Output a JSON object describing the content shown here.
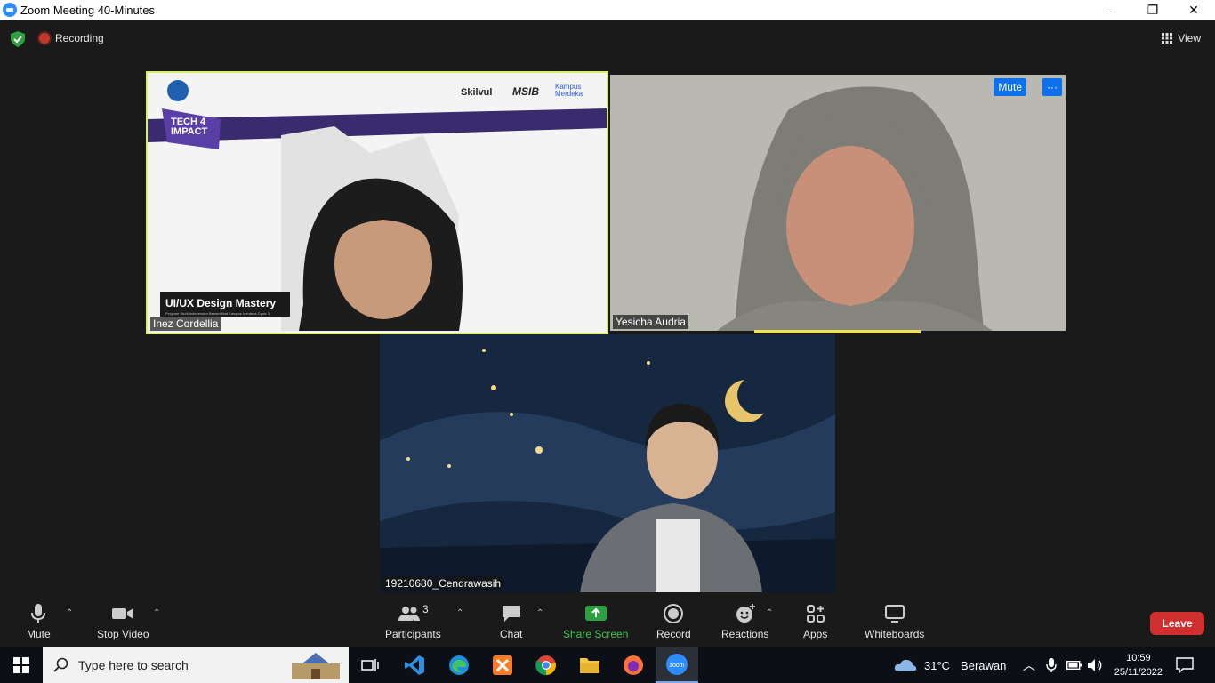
{
  "window": {
    "title": "Zoom Meeting 40-Minutes",
    "min": "–",
    "max": "❐",
    "close": "✕"
  },
  "topbar": {
    "recording": "Recording",
    "view": "View"
  },
  "participants": [
    {
      "name": "Inez Cordellia",
      "banner_title": "UI/UX Design Mastery",
      "banner_sub": "Program Studi Independen Bersertifikat Kampus Merdeka Cycle 3",
      "brand1": "Skilvul",
      "brand2": "MSIB",
      "brand3": "Kampus Merdeka",
      "event": "TECH 4 IMPACT"
    },
    {
      "name": "Yesicha Audria",
      "mute_label": "Mute",
      "more_label": "···"
    },
    {
      "name": "19210680_Cendrawasih"
    }
  ],
  "toolbar": {
    "mute": "Mute",
    "stop_video": "Stop Video",
    "participants": "Participants",
    "participants_count": "3",
    "chat": "Chat",
    "share_screen": "Share Screen",
    "record": "Record",
    "reactions": "Reactions",
    "apps": "Apps",
    "whiteboards": "Whiteboards",
    "leave": "Leave"
  },
  "taskbar": {
    "search_placeholder": "Type here to search",
    "weather_temp": "31°C",
    "weather_desc": "Berawan",
    "time": "10:59",
    "date": "25/11/2022"
  },
  "colors": {
    "accent": "#0e71eb",
    "leave": "#d12e2e",
    "share": "#3fc455",
    "speaker_border": "#d6f06a"
  }
}
